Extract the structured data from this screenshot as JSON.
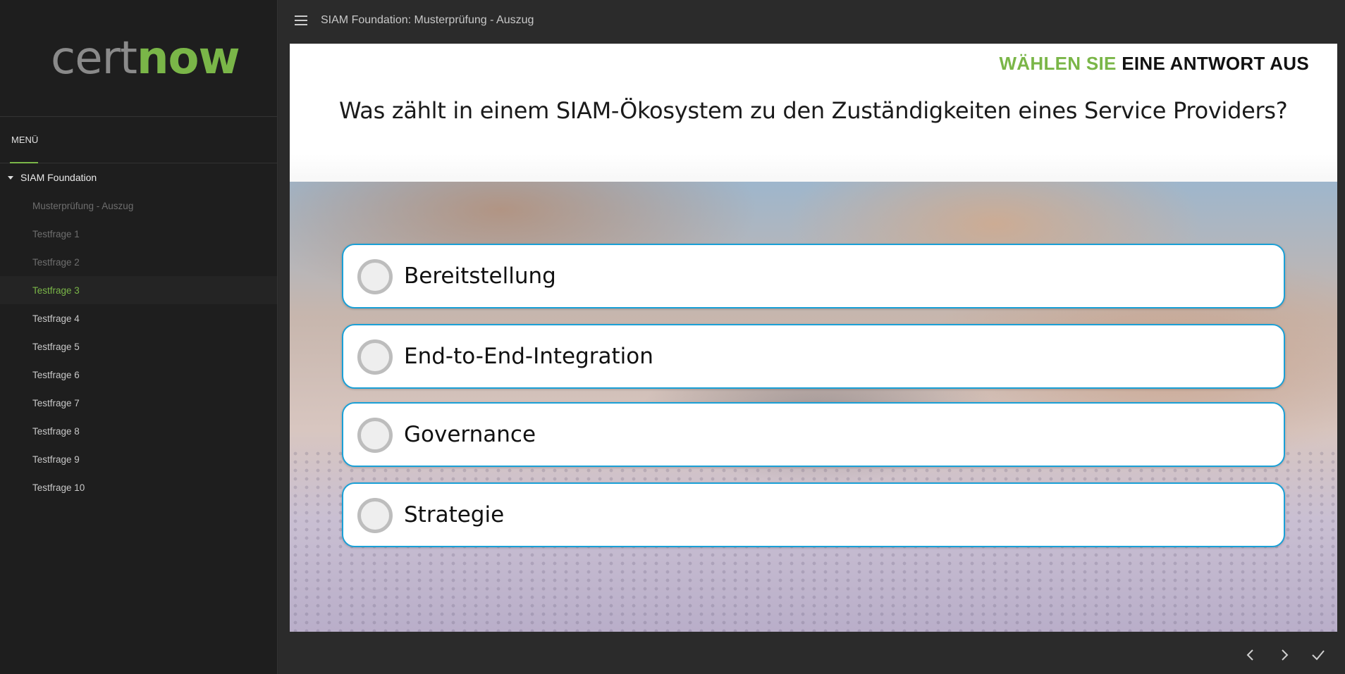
{
  "sidebar": {
    "logo": {
      "cert": "cert",
      "now": "now"
    },
    "menu_label": "MENÜ",
    "root": "SIAM Foundation",
    "items": [
      {
        "label": "Musterprüfung - Auszug",
        "state": "muted"
      },
      {
        "label": "Testfrage 1",
        "state": "muted"
      },
      {
        "label": "Testfrage 2",
        "state": "muted"
      },
      {
        "label": "Testfrage 3",
        "state": "active"
      },
      {
        "label": "Testfrage 4",
        "state": "normal"
      },
      {
        "label": "Testfrage 5",
        "state": "normal"
      },
      {
        "label": "Testfrage 6",
        "state": "normal"
      },
      {
        "label": "Testfrage 7",
        "state": "normal"
      },
      {
        "label": "Testfrage 8",
        "state": "normal"
      },
      {
        "label": "Testfrage 9",
        "state": "normal"
      },
      {
        "label": "Testfrage 10",
        "state": "normal"
      }
    ]
  },
  "header": {
    "title": "SIAM Foundation: Musterprüfung - Auszug",
    "menu_icon": "hamburger-icon"
  },
  "slide": {
    "instruction_green": "WÄHLEN SIE",
    "instruction_black": "EINE ANTWORT AUS",
    "question": "Was zählt in einem SIAM-Ökosystem zu den Zuständigkeiten eines Service Providers?",
    "answers": [
      {
        "label": "Bereitstellung"
      },
      {
        "label": "End-to-End-Integration"
      },
      {
        "label": "Governance"
      },
      {
        "label": "Strategie"
      }
    ]
  },
  "nav": {
    "prev_icon": "chevron-left-icon",
    "next_icon": "chevron-right-icon",
    "submit_icon": "check-icon"
  },
  "colors": {
    "accent": "#7ab648",
    "answer_border": "#1aa0d6",
    "sidebar_bg": "#1e1e1e",
    "main_bg": "#2b2b2b"
  }
}
